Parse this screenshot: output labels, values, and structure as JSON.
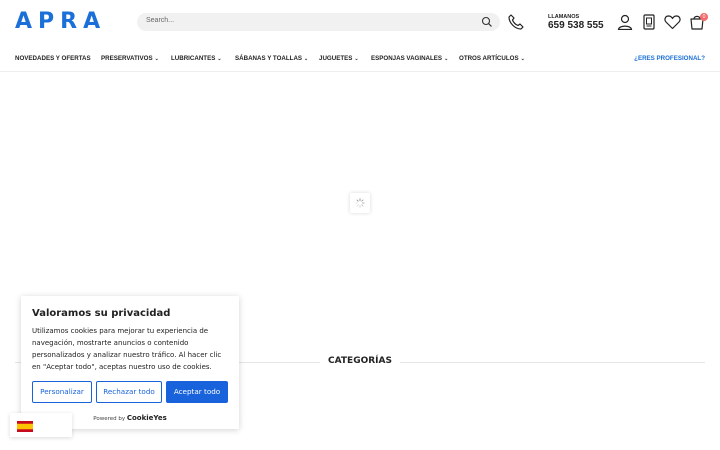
{
  "header": {
    "logo": "APRA",
    "search_placeholder": "Search...",
    "call_label": "LLAMANOS",
    "call_number": "659 538 555",
    "cart_count": "0"
  },
  "nav": {
    "items": [
      {
        "label": "NOVEDADES Y OFERTAS",
        "has_dropdown": false
      },
      {
        "label": "PRESERVATIVOS",
        "has_dropdown": true
      },
      {
        "label": "LUBRICANTES",
        "has_dropdown": true
      },
      {
        "label": "SÁBANAS Y TOALLAS",
        "has_dropdown": true
      },
      {
        "label": "JUGUETES",
        "has_dropdown": true
      },
      {
        "label": "ESPONJAS VAGINALES",
        "has_dropdown": true
      },
      {
        "label": "OTROS ARTÍCULOS",
        "has_dropdown": true
      }
    ],
    "pro_link": "¿ERES PROFESIONAL?"
  },
  "main": {
    "categories_title": "CATEGORÍAS"
  },
  "cookie_banner": {
    "title": "Valoramos su privacidad",
    "body": "Utilizamos cookies para mejorar tu experiencia de navegación, mostrarte anuncios o contenido personalizados y analizar nuestro tráfico. Al hacer clic en \"Aceptar todo\", aceptas nuestro uso de cookies.",
    "customize_label": "Personalizar",
    "reject_label": "Rechazar todo",
    "accept_label": "Aceptar todo",
    "powered_by": "Powered by",
    "powered_brand": "CookieYes"
  },
  "colors": {
    "brand": "#1a6fd8",
    "cookie_button": "#1863dc",
    "badge": "#f36b6b"
  }
}
